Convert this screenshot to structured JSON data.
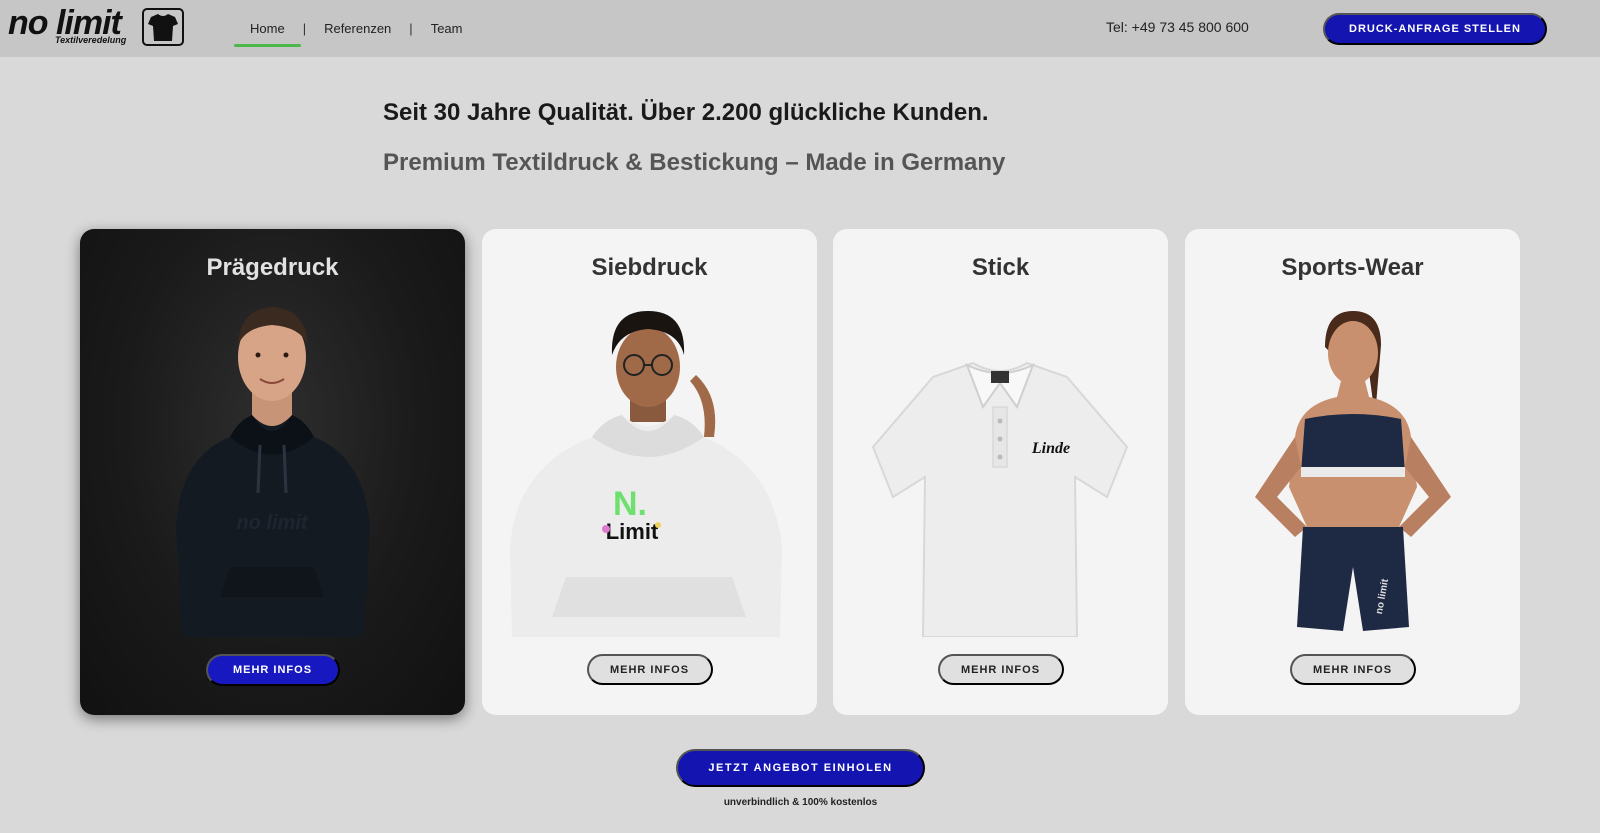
{
  "header": {
    "logo_text": "no limit",
    "logo_sub": "Textilveredelung",
    "nav": [
      {
        "label": "Home",
        "active": true
      },
      {
        "label": "Referenzen",
        "active": false
      },
      {
        "label": "Team",
        "active": false
      }
    ],
    "separator": "|",
    "phone": "Tel: +49 73 45 800 600",
    "cta_label": "DRUCK-ANFRAGE STELLEN"
  },
  "hero": {
    "title": "Seit 30 Jahre Qualität. Über 2.200 glückliche Kunden.",
    "subtitle": "Premium Textildruck & Bestickung – Made in Germany"
  },
  "cards": [
    {
      "title": "Prägedruck",
      "button": "MEHR INFOS",
      "image": "man-black-hoodie",
      "print_text": "no limit"
    },
    {
      "title": "Siebdruck",
      "button": "MEHR INFOS",
      "image": "man-white-hoodie",
      "print_text": "Limit"
    },
    {
      "title": "Stick",
      "button": "MEHR INFOS",
      "image": "white-polo-shirt",
      "print_text": "Linde"
    },
    {
      "title": "Sports-Wear",
      "button": "MEHR INFOS",
      "image": "woman-sportswear",
      "print_text": "no limit"
    }
  ],
  "cta": {
    "label": "JETZT ANGEBOT EINHOLEN",
    "note": "unverbindlich & 100% kostenlos"
  },
  "colors": {
    "accent_blue": "#1414b0",
    "nav_active": "#4cb84c",
    "header_bg": "#c6c6c6",
    "page_bg": "#d9d9d9"
  }
}
